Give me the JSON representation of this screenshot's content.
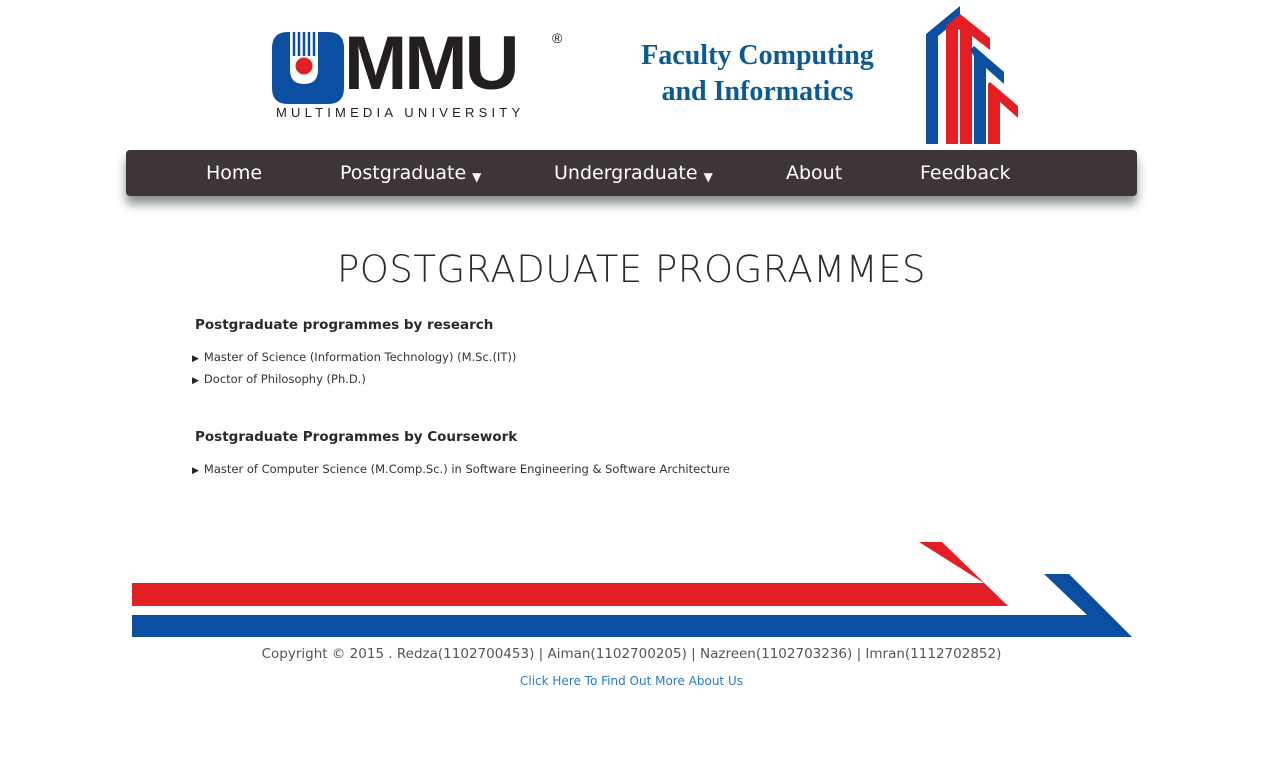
{
  "header": {
    "logo_text": "MMU",
    "logo_registered": "®",
    "logo_subtitle": "MULTIMEDIA UNIVERSITY",
    "faculty_line1": "Faculty Computing",
    "faculty_line2": "and Informatics"
  },
  "nav": {
    "items": [
      {
        "label": "Home",
        "has_dropdown": false
      },
      {
        "label": "Postgraduate",
        "has_dropdown": true
      },
      {
        "label": "Undergraduate",
        "has_dropdown": true
      },
      {
        "label": "About",
        "has_dropdown": false
      },
      {
        "label": "Feedback",
        "has_dropdown": false
      }
    ],
    "caret": "▼"
  },
  "main": {
    "title": "POSTGRADUATE PROGRAMMES",
    "sections": [
      {
        "heading": "Postgraduate programmes by research",
        "items": [
          "Master of Science (Information Technology) (M.Sc.(IT))",
          "Doctor of Philosophy (Ph.D.)"
        ]
      },
      {
        "heading": "Postgraduate Programmes by Coursework",
        "items": [
          "Master of Computer Science (M.Comp.Sc.) in Software Engineering & Software Architecture"
        ]
      }
    ],
    "bullet": "▶"
  },
  "footer": {
    "copyright": "Copyright © 2015 . Redza(1102700453) | Aiman(1102700205) | Nazreen(1102703236) | Imran(1112702852)",
    "about_link": "Click Here To Find Out More About Us"
  },
  "colors": {
    "brand_red": "#e31e24",
    "brand_blue": "#0b4ea2",
    "nav_bg": "#3d3536",
    "faculty_text": "#0c5a92",
    "link": "#2a7bbf"
  },
  "icons": {
    "logo_mark": "mmu-logo-mark-icon",
    "faculty_arrows": "faculty-arrows-icon",
    "footer_stripes": "footer-stripes-decoration"
  }
}
